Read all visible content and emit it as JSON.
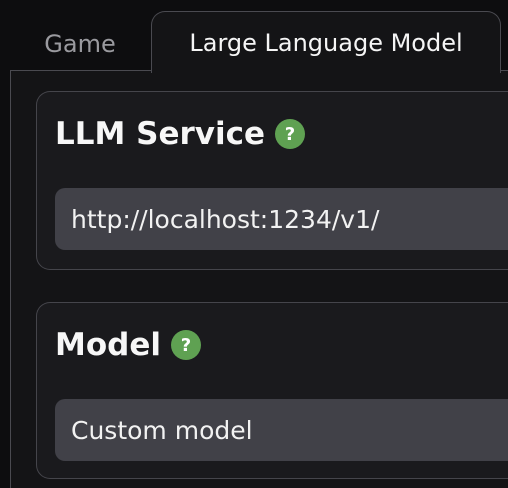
{
  "tabs": [
    {
      "label": "Game",
      "active": false
    },
    {
      "label": "Large Language Model",
      "active": true
    }
  ],
  "llm_service": {
    "title": "LLM Service",
    "help_glyph": "?",
    "value": "http://localhost:1234/v1/"
  },
  "model": {
    "title": "Model",
    "help_glyph": "?",
    "value": "Custom model"
  },
  "colors": {
    "background": "#0d0d0f",
    "panel": "#141416",
    "card": "#1a1a1d",
    "field": "#414148",
    "help_icon": "#5fa152",
    "inactive_tab_text": "#9a9a9f"
  },
  "icons": {
    "help": "question-mark-circle-icon"
  }
}
